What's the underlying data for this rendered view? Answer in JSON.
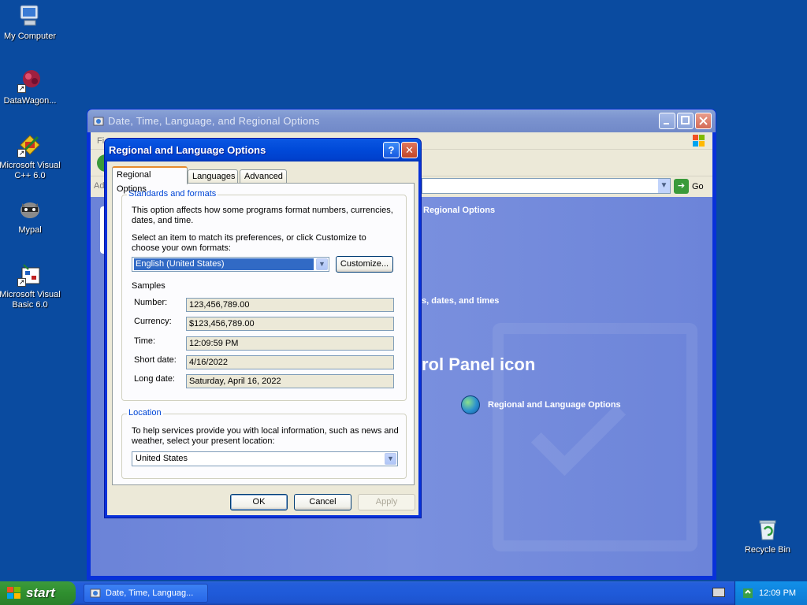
{
  "desktop": {
    "icons": [
      {
        "label": "My Computer"
      },
      {
        "label": "DataWagon..."
      },
      {
        "label": "Microsoft Visual C++ 6.0"
      },
      {
        "label": "Mypal"
      },
      {
        "label": "Microsoft Visual Basic 6.0"
      }
    ],
    "recycle_bin": "Recycle Bin"
  },
  "control_panel": {
    "title": "Date, Time, Language, and Regional Options",
    "menu_partial": "Fi",
    "address_partial": "Ad",
    "go_label": "Go",
    "header_partial": "Regional Options",
    "task_partial": "s, dates, and times",
    "pick_partial": "rol Panel icon",
    "item_label": "Regional and Language Options"
  },
  "dialog": {
    "title": "Regional and Language Options",
    "help_label": "?",
    "close_label": "✕",
    "tabs": [
      {
        "label": "Regional Options",
        "active": true
      },
      {
        "label": "Languages",
        "active": false
      },
      {
        "label": "Advanced",
        "active": false
      }
    ],
    "standards": {
      "legend": "Standards and formats",
      "description": "This option affects how some programs format numbers, currencies, dates, and time.",
      "select_prompt": "Select an item to match its preferences, or click Customize to choose your own formats:",
      "selected_locale": "English (United States)",
      "customize_label": "Customize...",
      "samples_heading": "Samples",
      "samples": [
        {
          "label": "Number:",
          "value": "123,456,789.00"
        },
        {
          "label": "Currency:",
          "value": "$123,456,789.00"
        },
        {
          "label": "Time:",
          "value": "12:09:59 PM"
        },
        {
          "label": "Short date:",
          "value": "4/16/2022"
        },
        {
          "label": "Long date:",
          "value": "Saturday, April 16, 2022"
        }
      ]
    },
    "location": {
      "legend": "Location",
      "description": "To help services provide you with local information, such as news and weather, select your present location:",
      "selected": "United States"
    },
    "buttons": {
      "ok": "OK",
      "cancel": "Cancel",
      "apply": "Apply"
    }
  },
  "taskbar": {
    "start_label": "start",
    "task_label": "Date, Time, Languag...",
    "clock": "12:09 PM"
  }
}
